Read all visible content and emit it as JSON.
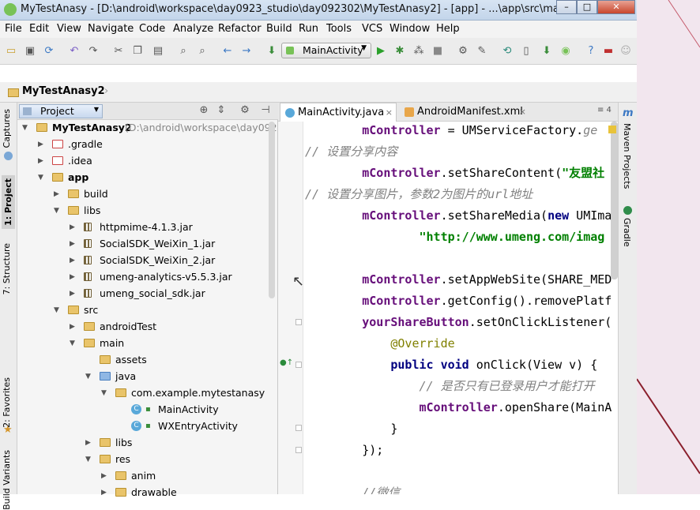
{
  "window": {
    "title": "MyTestAnasy - [D:\\android\\workspace\\day0923_studio\\day092302\\MyTestAnasy2] - [app] - ...\\app\\src\\main\\java\\co..."
  },
  "menu": [
    "File",
    "Edit",
    "View",
    "Navigate",
    "Code",
    "Analyze",
    "Refactor",
    "Build",
    "Run",
    "Tools",
    "VCS",
    "Window",
    "Help"
  ],
  "toolbar": {
    "run_config": "MainActivity"
  },
  "breadcrumb": {
    "project": "MyTestAnasy2"
  },
  "left_tabs": [
    "Captures",
    "1: Project",
    "7: Structure",
    "2: Favorites",
    "Build Variants"
  ],
  "project_panel": {
    "view_mode": "Project"
  },
  "tree": [
    {
      "label": "MyTestAnasy2",
      "extra": "(D:\\android\\workspace\\day092",
      "depth": 0,
      "type": "module",
      "open": true
    },
    {
      "label": ".gradle",
      "depth": 1,
      "type": "folder",
      "open": false
    },
    {
      "label": ".idea",
      "depth": 1,
      "type": "folder",
      "open": false
    },
    {
      "label": "app",
      "depth": 1,
      "type": "module",
      "open": true
    },
    {
      "label": "build",
      "depth": 2,
      "type": "folder",
      "open": false
    },
    {
      "label": "libs",
      "depth": 2,
      "type": "folder",
      "open": true
    },
    {
      "label": "httpmime-4.1.3.jar",
      "depth": 3,
      "type": "jar",
      "open": false
    },
    {
      "label": "SocialSDK_WeiXin_1.jar",
      "depth": 3,
      "type": "jar",
      "open": false
    },
    {
      "label": "SocialSDK_WeiXin_2.jar",
      "depth": 3,
      "type": "jar",
      "open": false
    },
    {
      "label": "umeng-analytics-v5.5.3.jar",
      "depth": 3,
      "type": "jar",
      "open": false
    },
    {
      "label": "umeng_social_sdk.jar",
      "depth": 3,
      "type": "jar",
      "open": false
    },
    {
      "label": "src",
      "depth": 2,
      "type": "folder",
      "open": true
    },
    {
      "label": "androidTest",
      "depth": 3,
      "type": "folder",
      "open": false
    },
    {
      "label": "main",
      "depth": 3,
      "type": "folder",
      "open": true
    },
    {
      "label": "assets",
      "depth": 4,
      "type": "folder",
      "open": null
    },
    {
      "label": "java",
      "depth": 4,
      "type": "srcfolder",
      "open": true
    },
    {
      "label": "com.example.mytestanasy",
      "depth": 5,
      "type": "package",
      "open": true
    },
    {
      "label": "MainActivity",
      "depth": 6,
      "type": "class",
      "open": null
    },
    {
      "label": "WXEntryActivity",
      "depth": 6,
      "type": "class",
      "open": null
    },
    {
      "label": "libs",
      "depth": 4,
      "type": "folder",
      "open": false
    },
    {
      "label": "res",
      "depth": 4,
      "type": "folder",
      "open": true
    },
    {
      "label": "anim",
      "depth": 5,
      "type": "folder",
      "open": false
    },
    {
      "label": "drawable",
      "depth": 5,
      "type": "folder",
      "open": false
    }
  ],
  "editor": {
    "tabs": [
      {
        "label": "MainActivity.java",
        "active": true
      },
      {
        "label": "AndroidManifest.xml",
        "active": false
      }
    ],
    "tab_overflow": "≡ 4",
    "lines": [
      [
        {
          "t": "        "
        },
        {
          "c": "fld",
          "t": "mController"
        },
        {
          "t": " = UMServiceFactory."
        },
        {
          "c": "cm",
          "t": "ge"
        }
      ],
      [
        {
          "c": "cm",
          "t": "// 设置分享内容"
        }
      ],
      [
        {
          "t": "        "
        },
        {
          "c": "fld",
          "t": "mController"
        },
        {
          "t": ".setShareContent("
        },
        {
          "c": "str",
          "t": "\"友盟社"
        }
      ],
      [
        {
          "c": "cm",
          "t": "// 设置分享图片，参数2为图片的url地址"
        }
      ],
      [
        {
          "t": "        "
        },
        {
          "c": "fld",
          "t": "mController"
        },
        {
          "t": ".setShareMedia("
        },
        {
          "c": "kw",
          "t": "new"
        },
        {
          "t": " UMIma"
        }
      ],
      [
        {
          "t": "                "
        },
        {
          "c": "str",
          "t": "\"http://www.umeng.com/imag"
        }
      ],
      [
        {
          "t": ""
        }
      ],
      [
        {
          "t": "        "
        },
        {
          "c": "fld",
          "t": "mController"
        },
        {
          "t": ".setAppWebSite(SHARE_MED"
        }
      ],
      [
        {
          "t": "        "
        },
        {
          "c": "fld",
          "t": "mController"
        },
        {
          "t": ".getConfig().removePlatf"
        }
      ],
      [
        {
          "t": "        "
        },
        {
          "c": "fld",
          "t": "yourShareButton"
        },
        {
          "t": ".setOnClickListener("
        }
      ],
      [
        {
          "t": "            "
        },
        {
          "c": "ann",
          "t": "@Override"
        }
      ],
      [
        {
          "t": "            "
        },
        {
          "c": "kw",
          "t": "public void"
        },
        {
          "t": " onClick(View v) {"
        }
      ],
      [
        {
          "t": "                "
        },
        {
          "c": "cm",
          "t": "// 是否只有已登录用户才能打开"
        }
      ],
      [
        {
          "t": "                "
        },
        {
          "c": "fld",
          "t": "mController"
        },
        {
          "t": ".openShare(MainA"
        }
      ],
      [
        {
          "t": "            }"
        }
      ],
      [
        {
          "t": "        });"
        }
      ],
      [
        {
          "t": ""
        }
      ],
      [
        {
          "t": "        "
        },
        {
          "c": "cm",
          "t": "//微信"
        }
      ]
    ]
  },
  "right_tabs": [
    "Maven Projects",
    "Gradle"
  ],
  "colors": {
    "accent": "#59a8d9",
    "keyword": "#000080",
    "field": "#660e7a",
    "comment": "#808080",
    "string": "#008000"
  }
}
